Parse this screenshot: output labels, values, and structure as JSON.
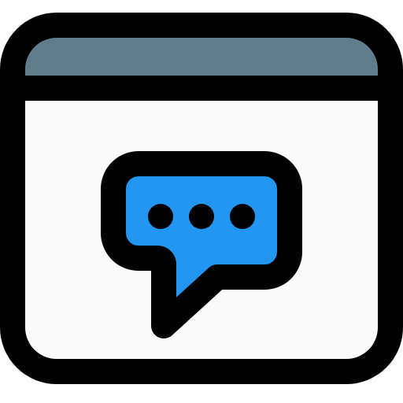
{
  "icon": {
    "name": "browser-window-chat-icon",
    "colors": {
      "outline": "#000000",
      "title_bar": "#607D8B",
      "window_body": "#FAFAFA",
      "chat_bubble": "#2196F3",
      "dots": "#000000"
    }
  }
}
